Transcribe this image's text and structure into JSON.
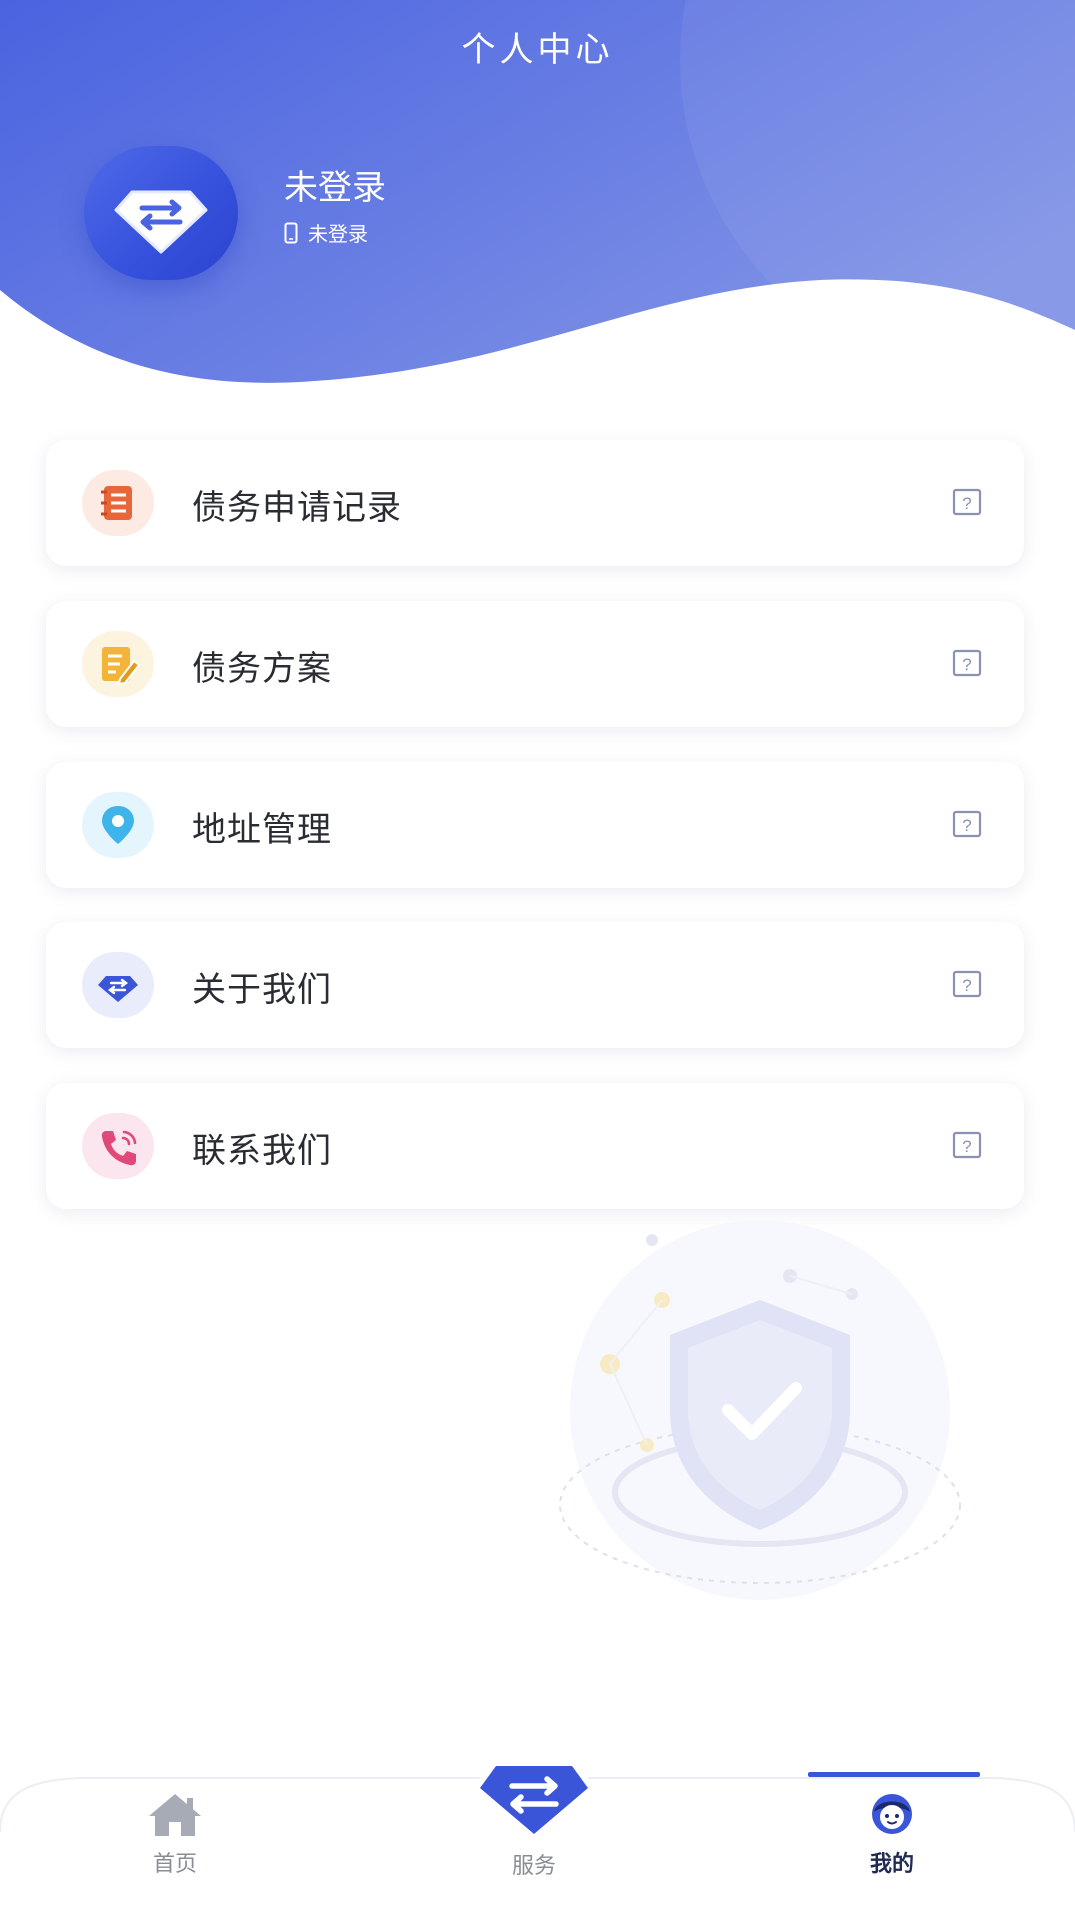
{
  "header": {
    "title": "个人中心",
    "user_name": "未登录",
    "user_phone": "未登录"
  },
  "menu": {
    "items": [
      {
        "label": "债务申请记录",
        "icon": "record-icon",
        "color": "#e8673a"
      },
      {
        "label": "债务方案",
        "icon": "plan-icon",
        "color": "#f2b43a"
      },
      {
        "label": "地址管理",
        "icon": "location-icon",
        "color": "#3fb4ea"
      },
      {
        "label": "关于我们",
        "icon": "diamond-icon",
        "color": "#3a55d8"
      },
      {
        "label": "联系我们",
        "icon": "phone-icon",
        "color": "#e04a7a"
      }
    ]
  },
  "tabbar": {
    "home_label": "首页",
    "service_label": "服务",
    "mine_label": "我的",
    "active": "我的"
  },
  "colors": {
    "brand": "#3a55d8",
    "header_start": "#4a63e0",
    "header_end": "#7e90e6"
  }
}
